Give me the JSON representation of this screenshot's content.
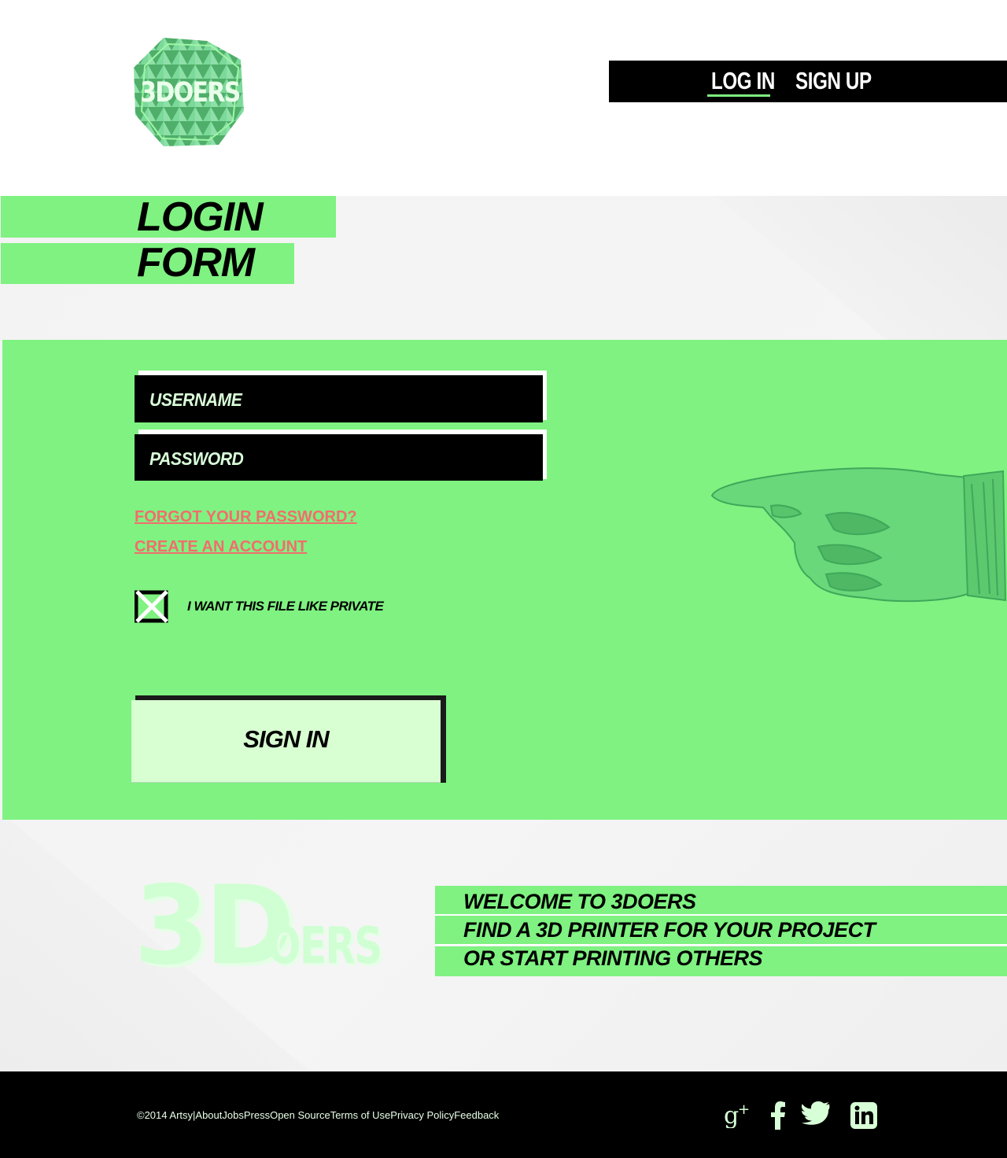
{
  "header": {
    "logo_text": "3DOERS",
    "nav": {
      "login": "LOG IN",
      "signup": "SIGN UP"
    }
  },
  "title": {
    "line1": "LOGIN",
    "line2": "FORM"
  },
  "form": {
    "username_placeholder": "USERNAME",
    "password_placeholder": "PASSWORD",
    "forgot_link": "FORGOT YOUR PASSWORD?",
    "create_link": "CREATE AN ACCOUNT",
    "private_checkbox": {
      "label": "I WANT THIS FILE LIKE PRIVATE",
      "checked": true
    },
    "submit_label": "SIGN IN"
  },
  "welcome": {
    "logo_text_big": "3D",
    "logo_text_small": "OERS",
    "lines": [
      "WELCOME TO 3DOERS",
      "FIND A 3D PRINTER FOR YOUR  PROJECT",
      "OR START PRINTING  OTHERS"
    ]
  },
  "footer": {
    "copyright": "©2014 Artsy",
    "separator": "|",
    "links": [
      "About",
      "Jobs",
      "Press",
      "Open Source",
      "Terms of Use",
      "Privacy Policy",
      "Feedback"
    ],
    "social": [
      "google-plus-icon",
      "facebook-icon",
      "twitter-icon",
      "linkedin-icon"
    ]
  },
  "colors": {
    "accent": "#7ff281",
    "link": "#f26d6d",
    "button_bg": "#d8ffd2",
    "dark": "#000000"
  }
}
